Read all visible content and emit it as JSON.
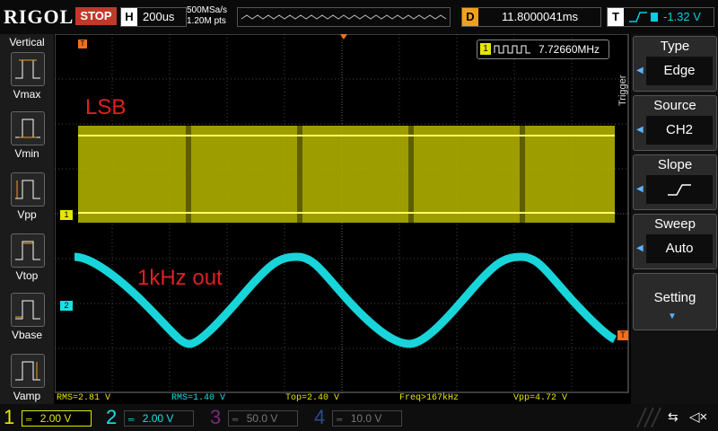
{
  "topbar": {
    "brand": "RIGOL",
    "run_state": "STOP",
    "timebase_label": "H",
    "timebase_value": "200us",
    "sample_rate": "500MSa/s",
    "mem_depth": "1.20M pts",
    "delay_label": "D",
    "delay_value": "11.8000041ms",
    "trigger_label": "T",
    "trigger_level": "-1.32 V"
  },
  "left_panel": {
    "title": "Vertical",
    "items": [
      "Vmax",
      "Vmin",
      "Vpp",
      "Vtop",
      "Vbase",
      "Vamp"
    ]
  },
  "screen": {
    "freq_counter_channel": "1",
    "freq_counter_value": "7.72660MHz",
    "annotation_lsb": "LSB",
    "annotation_out": "1kHz out",
    "ch1_marker": "1",
    "ch2_marker": "2",
    "trigger_marker": "T",
    "colors": {
      "ch1": "#e6e600",
      "ch2": "#19e0e6",
      "grid": "#444444",
      "annotation": "#e02020"
    }
  },
  "trigger_panel": {
    "title": "Trigger",
    "type_label": "Type",
    "type_value": "Edge",
    "source_label": "Source",
    "source_value": "CH2",
    "slope_label": "Slope",
    "slope_icon": "rising-edge-icon",
    "sweep_label": "Sweep",
    "sweep_value": "Auto",
    "setting_label": "Setting"
  },
  "measurements": [
    "RMS=2.81 V",
    "RMS=1.40 V",
    "Top=2.40 V",
    "Freq>167kHz",
    "Vpp=4.72 V"
  ],
  "channels": [
    {
      "num": "1",
      "scale": "2.00 V"
    },
    {
      "num": "2",
      "scale": "2.00 V"
    },
    {
      "num": "3",
      "scale": "50.0 V"
    },
    {
      "num": "4",
      "scale": "10.0 V"
    }
  ]
}
